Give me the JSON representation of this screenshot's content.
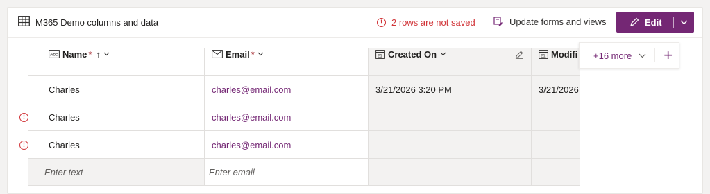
{
  "header": {
    "table_icon": "table-grid-icon",
    "title": "M365 Demo columns and data",
    "not_saved": "2 rows are not saved",
    "update_label": "Update forms and views",
    "edit_label": "Edit"
  },
  "columns": {
    "name": {
      "label": "Name",
      "required": "*",
      "icon": "text-abc-icon"
    },
    "email": {
      "label": "Email",
      "required": "*",
      "icon": "mail-icon"
    },
    "created": {
      "label": "Created On",
      "icon": "calendar-icon"
    },
    "modified": {
      "label": "Modifi",
      "icon": "calendar-icon"
    }
  },
  "more": {
    "label": "+16 more"
  },
  "rows": [
    {
      "name": "Charles",
      "email": "charles@email.com",
      "created": "3/21/2026 3:20 PM",
      "modified": "3/21/2026",
      "error": false
    },
    {
      "name": "Charles",
      "email": "charles@email.com",
      "created": "",
      "modified": "",
      "error": true
    },
    {
      "name": "Charles",
      "email": "charles@email.com",
      "created": "",
      "modified": "",
      "error": true
    }
  ],
  "new_row": {
    "name_placeholder": "Enter text",
    "email_placeholder": "Enter email"
  },
  "colors": {
    "accent": "#742774",
    "error": "#d13438",
    "readonly_bg": "#f3f2f1"
  }
}
